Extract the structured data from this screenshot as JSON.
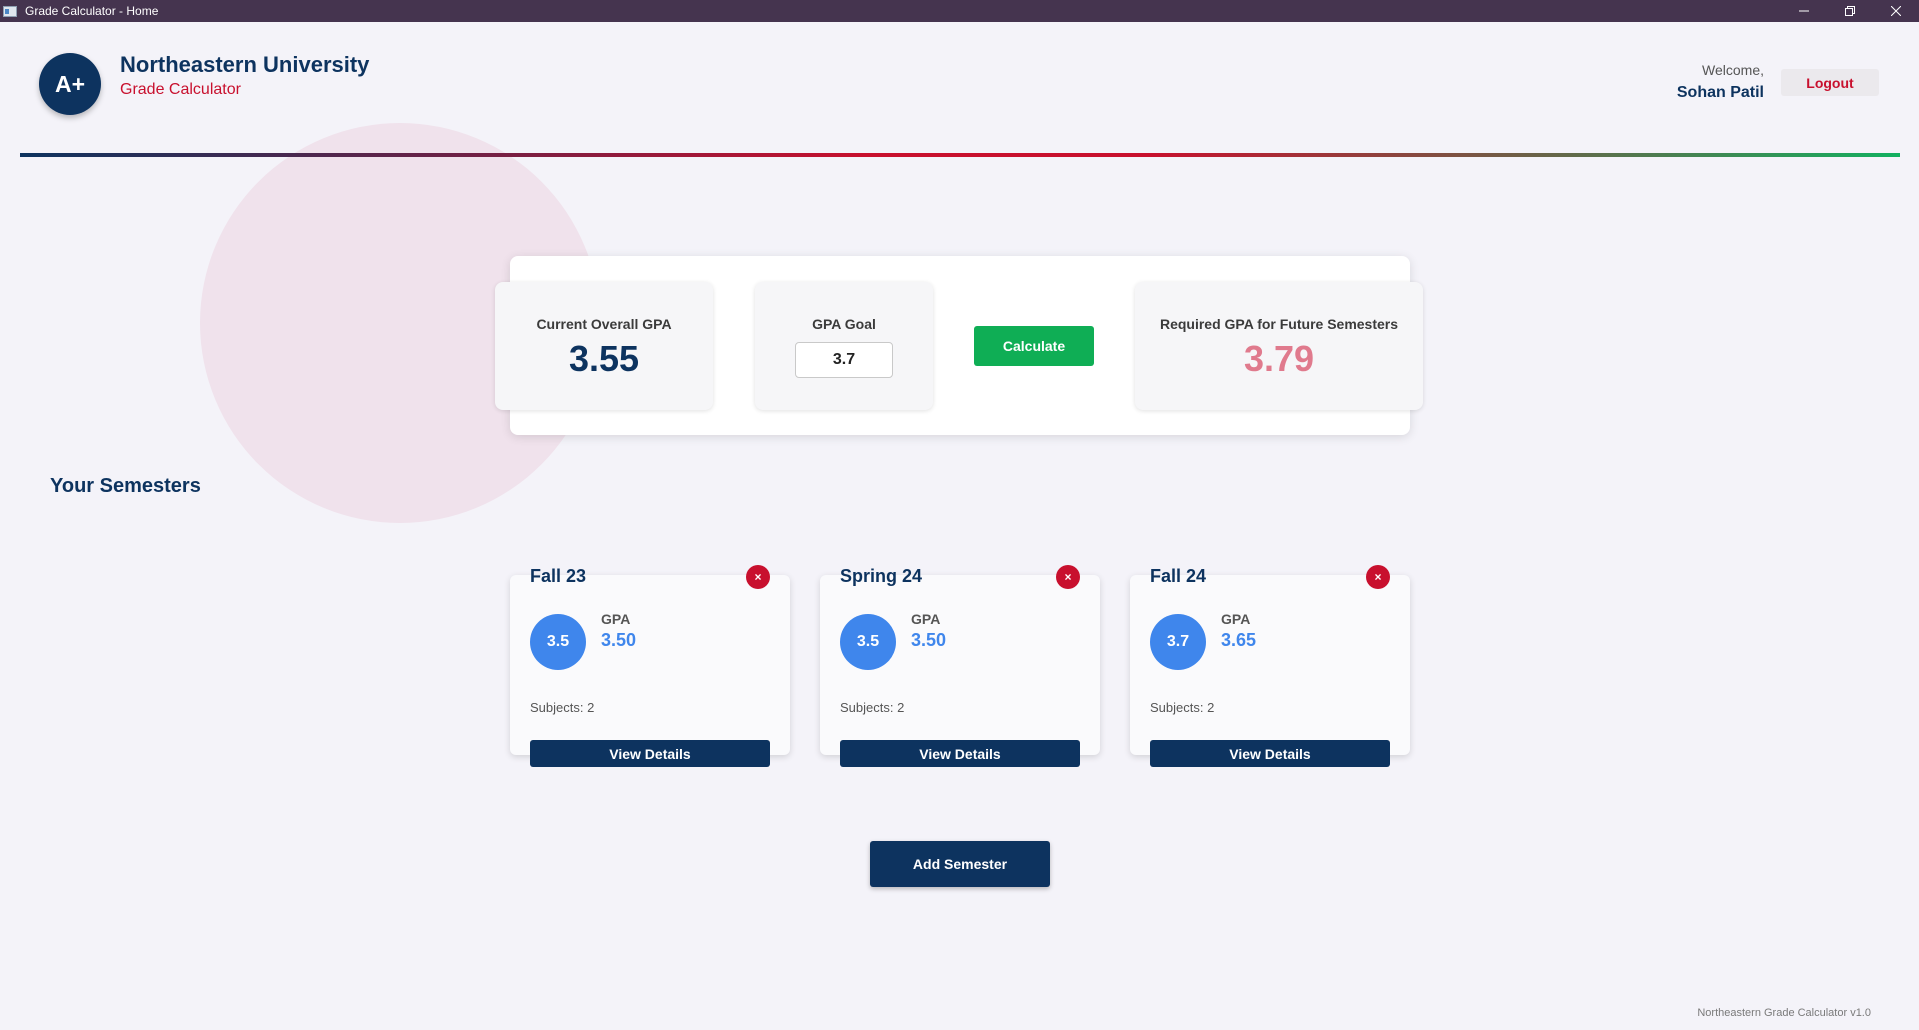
{
  "window": {
    "title": "Grade Calculator - Home",
    "controls": [
      "minimize-icon",
      "restore-icon",
      "close-icon"
    ]
  },
  "header": {
    "logo_text": "A+",
    "university": "Northeastern University",
    "app_name": "Grade Calculator",
    "welcome": "Welcome,",
    "user_name": "Sohan Patil",
    "logout_label": "Logout"
  },
  "gpa_panel": {
    "current_label": "Current Overall GPA",
    "current_value": "3.55",
    "goal_label": "GPA Goal",
    "goal_value": "3.7",
    "calculate_label": "Calculate",
    "required_label": "Required GPA for Future Semesters",
    "required_value": "3.79"
  },
  "semesters_section": {
    "title": "Your Semesters",
    "gpa_label": "GPA",
    "view_details_label": "View Details",
    "remove_symbol": "×",
    "items": [
      {
        "name": "Fall 23",
        "gpa_short": "3.5",
        "gpa": "3.50",
        "subjects": "Subjects: 2"
      },
      {
        "name": "Spring 24",
        "gpa_short": "3.5",
        "gpa": "3.50",
        "subjects": "Subjects: 2"
      },
      {
        "name": "Fall 24",
        "gpa_short": "3.7",
        "gpa": "3.65",
        "subjects": "Subjects: 2"
      }
    ],
    "add_label": "Add Semester"
  },
  "footer": {
    "version": "Northeastern Grade Calculator v1.0"
  },
  "colors": {
    "navy": "#0d335f",
    "red": "#c8102e",
    "green": "#0fae55",
    "blue": "#3f86ec",
    "pink": "#e07a8d"
  }
}
